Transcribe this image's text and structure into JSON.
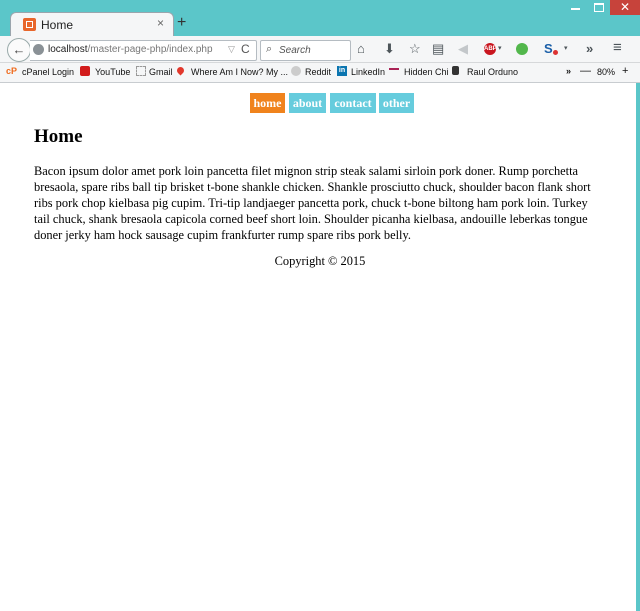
{
  "window": {
    "minimize": "–",
    "maximize": "□",
    "close": "✕"
  },
  "tab": {
    "title": "Home",
    "close": "×",
    "new_tab": "+"
  },
  "urlbar": {
    "host": "localhost",
    "path": "/master-page-php/index.php",
    "dropdown": "▽",
    "reload": "C"
  },
  "search": {
    "placeholder": "Search",
    "icon": "search-icon"
  },
  "toolbar": {
    "home": "⌂",
    "download": "⬇",
    "star": "☆",
    "clipboard": "▤",
    "send": "◀",
    "abp": "ABP",
    "s_ext": "S",
    "overflow": "»",
    "menu": "≡",
    "back": "←",
    "dropdown": "▾"
  },
  "bookmarks": {
    "items": [
      {
        "label": "cPanel Login",
        "icon": "cP"
      },
      {
        "label": "YouTube"
      },
      {
        "label": "Gmail"
      },
      {
        "label": "Where Am I Now? My ..."
      },
      {
        "label": "Reddit"
      },
      {
        "label": "LinkedIn",
        "icon": "in"
      },
      {
        "label": "Hidden Chi"
      },
      {
        "label": "Raul Orduno"
      }
    ],
    "more": "»",
    "zoom_out": "—",
    "zoom_level": "80%",
    "zoom_in": "+"
  },
  "page": {
    "nav": [
      {
        "label": "home"
      },
      {
        "label": "about"
      },
      {
        "label": "contact"
      },
      {
        "label": "other"
      }
    ],
    "heading": "Home",
    "body": "Bacon ipsum dolor amet pork loin pancetta filet mignon strip steak salami sirloin pork doner. Rump porchetta bresaola, spare ribs ball tip brisket t-bone shankle chicken. Shankle prosciutto chuck, shoulder bacon flank short ribs pork chop kielbasa pig cupim. Tri-tip landjaeger pancetta pork, chuck t-bone biltong ham pork loin. Turkey tail chuck, shank bresaola capicola corned beef short loin. Shoulder picanha kielbasa, andouille leberkas tongue doner jerky ham hock sausage cupim frankfurter rump spare ribs pork belly.",
    "copyright": "Copyright © 2015"
  },
  "colors": {
    "accent_active": "#f0831d",
    "nav_link": "#66ccdd",
    "window_frame": "#5bc6c9",
    "close_button": "#c7433b"
  }
}
